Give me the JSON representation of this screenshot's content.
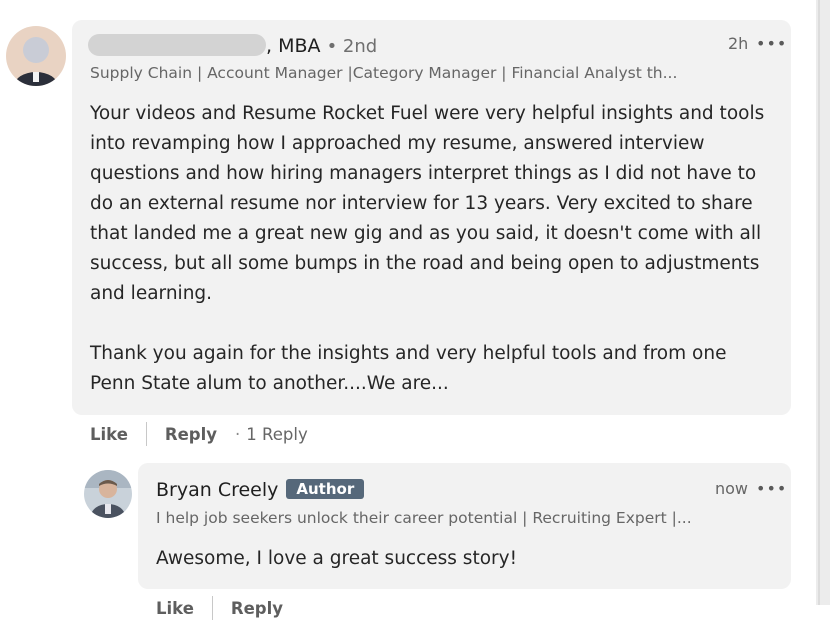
{
  "comment": {
    "name_suffix": ", MBA",
    "degree": "• 2nd",
    "headline": "Supply Chain | Account Manager |Category Manager | Financial Analyst th...",
    "time": "2h",
    "more": "•••",
    "body_lines": [
      "Your videos and Resume Rocket Fuel were very helpful insights and tools",
      "into revamping how I approached my resume, answered interview",
      "questions and how hiring managers interpret things as I did not have to",
      "do an external resume nor interview for 13 years. Very excited to share",
      "that landed me a great new gig and as you said, it doesn't come with all",
      "success, but all some bumps in the road and being open to adjustments",
      "and learning."
    ],
    "body_lines_2": [
      "Thank you again for the insights and very helpful tools and from one",
      "Penn State alum to another....We are..."
    ],
    "actions": {
      "like": "Like",
      "reply": "Reply",
      "replies_count": "1 Reply"
    }
  },
  "reply": {
    "name": "Bryan Creely",
    "badge": "Author",
    "headline": "I help job seekers unlock their career potential | Recruiting Expert |...",
    "time": "now",
    "more": "•••",
    "body": "Awesome, I love a great success story!",
    "actions": {
      "like": "Like",
      "reply": "Reply"
    }
  },
  "icons": {
    "commenter_avatar": "blurred-profile-photo",
    "reply_avatar": "profile-photo"
  }
}
